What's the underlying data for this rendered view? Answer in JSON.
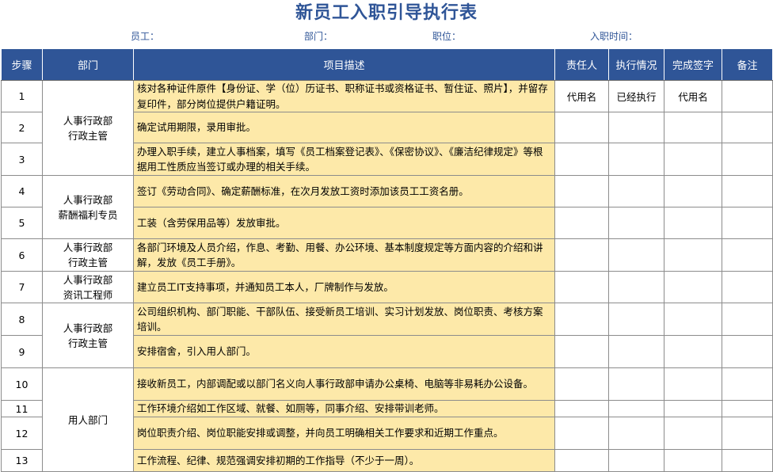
{
  "title": "新员工入职引导执行表",
  "info": {
    "employee_label": "员工：",
    "dept_label": "部门：",
    "position_label": "职位：",
    "date_label": "入职时间："
  },
  "headers": {
    "step": "步骤",
    "dept": "部门",
    "desc": "项目描述",
    "owner": "责任人",
    "status": "执行情况",
    "sign": "完成签字",
    "remark": "备注"
  },
  "depts": {
    "d1": "人事行政部\n行政主管",
    "d2": "人事行政部\n薪酬福利专员",
    "d3": "人事行政部\n行政主管",
    "d4": "人事行政部\n资讯工程师",
    "d5": "人事行政部\n行政主管",
    "d6": "用人部门"
  },
  "rows": [
    {
      "step": "1",
      "desc": "核对各种证件原件【身份证、学（位）历证书、职称证书或资格证书、暂住证、照片】，并留存复印件，部分岗位提供户籍证明。",
      "owner": "代用名",
      "status": "已经执行",
      "sign": "代用名",
      "remark": ""
    },
    {
      "step": "2",
      "desc": "确定试用期限，录用审批。",
      "owner": "",
      "status": "",
      "sign": "",
      "remark": ""
    },
    {
      "step": "3",
      "desc": "办理入职手续，建立人事档案，填写《员工档案登记表》、《保密协议》、《廉洁纪律规定》等根据用工性质应当签订或办理的相关手续。",
      "owner": "",
      "status": "",
      "sign": "",
      "remark": ""
    },
    {
      "step": "4",
      "desc": "签订《劳动合同》、确定薪酬标准，在次月发放工资时添加该员工工资名册。",
      "owner": "",
      "status": "",
      "sign": "",
      "remark": ""
    },
    {
      "step": "5",
      "desc": "工装（含劳保用品等）发放审批。",
      "owner": "",
      "status": "",
      "sign": "",
      "remark": ""
    },
    {
      "step": "6",
      "desc": "各部门环境及人员介绍，作息、考勤、用餐、办公环境、基本制度规定等方面内容的介绍和讲解，发放《员工手册》。",
      "owner": "",
      "status": "",
      "sign": "",
      "remark": ""
    },
    {
      "step": "7",
      "desc": "建立员工IT支持事项，并通知员工本人，厂牌制作与发放。",
      "owner": "",
      "status": "",
      "sign": "",
      "remark": ""
    },
    {
      "step": "8",
      "desc": "公司组织机构、部门职能、干部队伍、接受新员工培训、实习计划发放、岗位职责、考核方案培训。",
      "owner": "",
      "status": "",
      "sign": "",
      "remark": ""
    },
    {
      "step": "9",
      "desc": "安排宿舍，引入用人部门。",
      "owner": "",
      "status": "",
      "sign": "",
      "remark": ""
    },
    {
      "step": "10",
      "desc": "接收新员工，内部调配或以部门名义向人事行政部申请办公桌椅、电脑等非易耗办公设备。",
      "owner": "",
      "status": "",
      "sign": "",
      "remark": ""
    },
    {
      "step": "11",
      "desc": "工作环境介绍如工作区域、就餐、如厕等，同事介绍、安排带训老师。",
      "owner": "",
      "status": "",
      "sign": "",
      "remark": ""
    },
    {
      "step": "12",
      "desc": "岗位职责介绍、岗位职能安排或调整，并向员工明确相关工作要求和近期工作重点。",
      "owner": "",
      "status": "",
      "sign": "",
      "remark": ""
    },
    {
      "step": "13",
      "desc": "工作流程、纪律、规范强调安排初期的工作指导（不少于一周）。",
      "owner": "",
      "status": "",
      "sign": "",
      "remark": ""
    }
  ]
}
